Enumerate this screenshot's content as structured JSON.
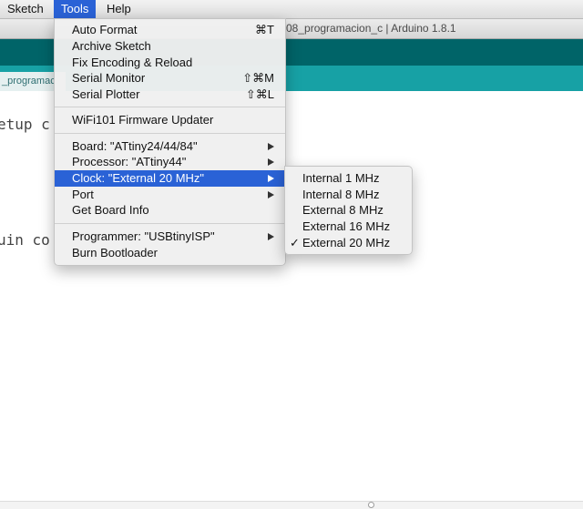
{
  "menubar": {
    "items": [
      "Sketch",
      "Tools",
      "Help"
    ],
    "active_index": 1
  },
  "window": {
    "title": "08_programacion_c | Arduino 1.8.1"
  },
  "tabs": {
    "active_label": "_programac"
  },
  "editor": {
    "lines": [
      "etup c",
      "uin co"
    ]
  },
  "tools_menu": {
    "group1": [
      {
        "label": "Auto Format",
        "shortcut": "⌘T"
      },
      {
        "label": "Archive Sketch",
        "shortcut": ""
      },
      {
        "label": "Fix Encoding & Reload",
        "shortcut": ""
      },
      {
        "label": "Serial Monitor",
        "shortcut": "⇧⌘M"
      },
      {
        "label": "Serial Plotter",
        "shortcut": "⇧⌘L"
      }
    ],
    "group2": [
      {
        "label": "WiFi101 Firmware Updater"
      }
    ],
    "group3": [
      {
        "label": "Board: \"ATtiny24/44/84\"",
        "submenu": true
      },
      {
        "label": "Processor: \"ATtiny44\"",
        "submenu": true
      },
      {
        "label": "Clock: \"External 20 MHz\"",
        "submenu": true,
        "highlighted": true
      },
      {
        "label": "Port",
        "submenu": true
      },
      {
        "label": "Get Board Info",
        "submenu": false
      }
    ],
    "group4": [
      {
        "label": "Programmer: \"USBtinyISP\"",
        "submenu": true
      },
      {
        "label": "Burn Bootloader",
        "submenu": false
      }
    ]
  },
  "clock_submenu": {
    "options": [
      "Internal 1 MHz",
      "Internal 8 MHz",
      "External 8 MHz",
      "External 16 MHz",
      "External 20 MHz"
    ],
    "checked": "External 20 MHz",
    "check_mark": "✓"
  },
  "colors": {
    "toolbar": "#006468",
    "tabstrip": "#17a1a5",
    "menu_highlight": "#2a62d6"
  }
}
